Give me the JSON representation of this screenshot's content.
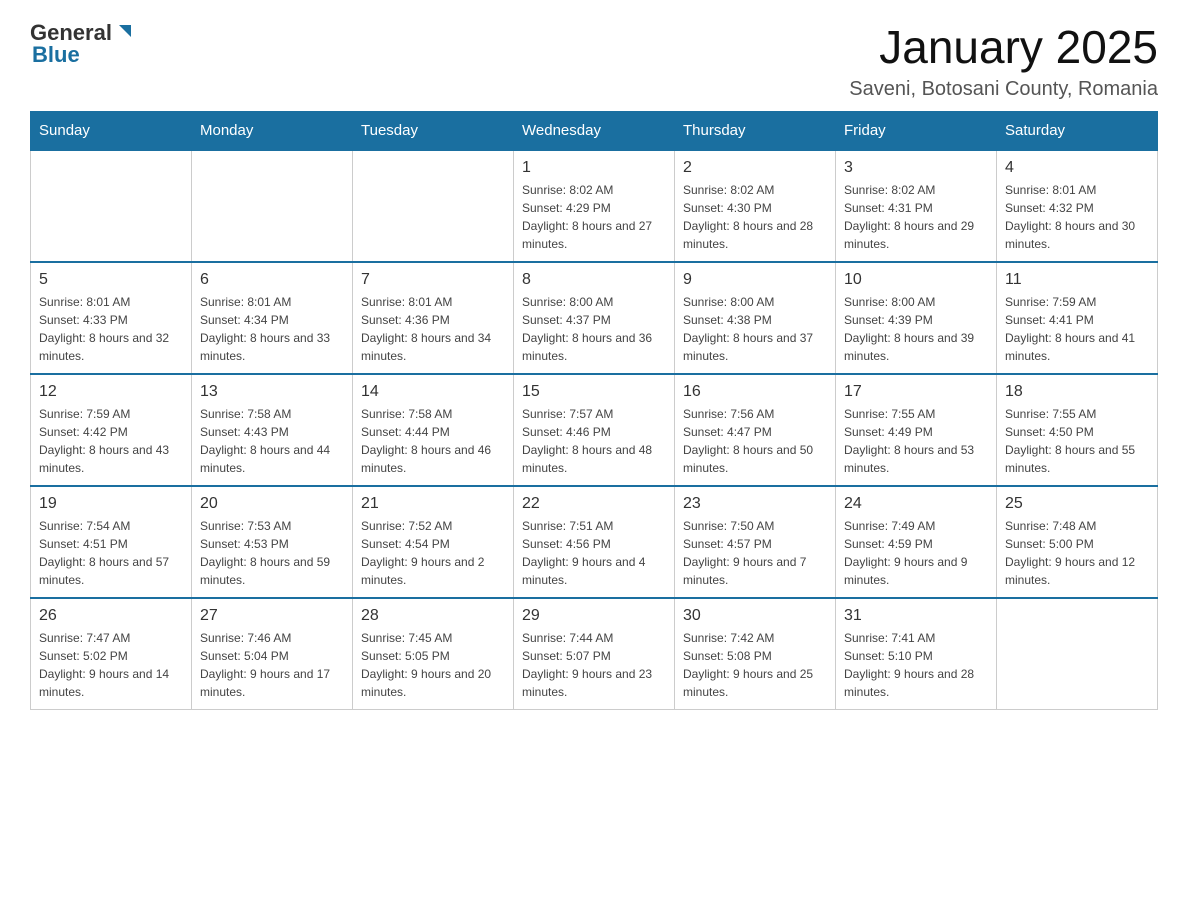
{
  "header": {
    "logo_general": "General",
    "logo_blue": "Blue",
    "title": "January 2025",
    "subtitle": "Saveni, Botosani County, Romania"
  },
  "days_of_week": [
    "Sunday",
    "Monday",
    "Tuesday",
    "Wednesday",
    "Thursday",
    "Friday",
    "Saturday"
  ],
  "weeks": [
    [
      {
        "day": "",
        "info": ""
      },
      {
        "day": "",
        "info": ""
      },
      {
        "day": "",
        "info": ""
      },
      {
        "day": "1",
        "info": "Sunrise: 8:02 AM\nSunset: 4:29 PM\nDaylight: 8 hours and 27 minutes."
      },
      {
        "day": "2",
        "info": "Sunrise: 8:02 AM\nSunset: 4:30 PM\nDaylight: 8 hours and 28 minutes."
      },
      {
        "day": "3",
        "info": "Sunrise: 8:02 AM\nSunset: 4:31 PM\nDaylight: 8 hours and 29 minutes."
      },
      {
        "day": "4",
        "info": "Sunrise: 8:01 AM\nSunset: 4:32 PM\nDaylight: 8 hours and 30 minutes."
      }
    ],
    [
      {
        "day": "5",
        "info": "Sunrise: 8:01 AM\nSunset: 4:33 PM\nDaylight: 8 hours and 32 minutes."
      },
      {
        "day": "6",
        "info": "Sunrise: 8:01 AM\nSunset: 4:34 PM\nDaylight: 8 hours and 33 minutes."
      },
      {
        "day": "7",
        "info": "Sunrise: 8:01 AM\nSunset: 4:36 PM\nDaylight: 8 hours and 34 minutes."
      },
      {
        "day": "8",
        "info": "Sunrise: 8:00 AM\nSunset: 4:37 PM\nDaylight: 8 hours and 36 minutes."
      },
      {
        "day": "9",
        "info": "Sunrise: 8:00 AM\nSunset: 4:38 PM\nDaylight: 8 hours and 37 minutes."
      },
      {
        "day": "10",
        "info": "Sunrise: 8:00 AM\nSunset: 4:39 PM\nDaylight: 8 hours and 39 minutes."
      },
      {
        "day": "11",
        "info": "Sunrise: 7:59 AM\nSunset: 4:41 PM\nDaylight: 8 hours and 41 minutes."
      }
    ],
    [
      {
        "day": "12",
        "info": "Sunrise: 7:59 AM\nSunset: 4:42 PM\nDaylight: 8 hours and 43 minutes."
      },
      {
        "day": "13",
        "info": "Sunrise: 7:58 AM\nSunset: 4:43 PM\nDaylight: 8 hours and 44 minutes."
      },
      {
        "day": "14",
        "info": "Sunrise: 7:58 AM\nSunset: 4:44 PM\nDaylight: 8 hours and 46 minutes."
      },
      {
        "day": "15",
        "info": "Sunrise: 7:57 AM\nSunset: 4:46 PM\nDaylight: 8 hours and 48 minutes."
      },
      {
        "day": "16",
        "info": "Sunrise: 7:56 AM\nSunset: 4:47 PM\nDaylight: 8 hours and 50 minutes."
      },
      {
        "day": "17",
        "info": "Sunrise: 7:55 AM\nSunset: 4:49 PM\nDaylight: 8 hours and 53 minutes."
      },
      {
        "day": "18",
        "info": "Sunrise: 7:55 AM\nSunset: 4:50 PM\nDaylight: 8 hours and 55 minutes."
      }
    ],
    [
      {
        "day": "19",
        "info": "Sunrise: 7:54 AM\nSunset: 4:51 PM\nDaylight: 8 hours and 57 minutes."
      },
      {
        "day": "20",
        "info": "Sunrise: 7:53 AM\nSunset: 4:53 PM\nDaylight: 8 hours and 59 minutes."
      },
      {
        "day": "21",
        "info": "Sunrise: 7:52 AM\nSunset: 4:54 PM\nDaylight: 9 hours and 2 minutes."
      },
      {
        "day": "22",
        "info": "Sunrise: 7:51 AM\nSunset: 4:56 PM\nDaylight: 9 hours and 4 minutes."
      },
      {
        "day": "23",
        "info": "Sunrise: 7:50 AM\nSunset: 4:57 PM\nDaylight: 9 hours and 7 minutes."
      },
      {
        "day": "24",
        "info": "Sunrise: 7:49 AM\nSunset: 4:59 PM\nDaylight: 9 hours and 9 minutes."
      },
      {
        "day": "25",
        "info": "Sunrise: 7:48 AM\nSunset: 5:00 PM\nDaylight: 9 hours and 12 minutes."
      }
    ],
    [
      {
        "day": "26",
        "info": "Sunrise: 7:47 AM\nSunset: 5:02 PM\nDaylight: 9 hours and 14 minutes."
      },
      {
        "day": "27",
        "info": "Sunrise: 7:46 AM\nSunset: 5:04 PM\nDaylight: 9 hours and 17 minutes."
      },
      {
        "day": "28",
        "info": "Sunrise: 7:45 AM\nSunset: 5:05 PM\nDaylight: 9 hours and 20 minutes."
      },
      {
        "day": "29",
        "info": "Sunrise: 7:44 AM\nSunset: 5:07 PM\nDaylight: 9 hours and 23 minutes."
      },
      {
        "day": "30",
        "info": "Sunrise: 7:42 AM\nSunset: 5:08 PM\nDaylight: 9 hours and 25 minutes."
      },
      {
        "day": "31",
        "info": "Sunrise: 7:41 AM\nSunset: 5:10 PM\nDaylight: 9 hours and 28 minutes."
      },
      {
        "day": "",
        "info": ""
      }
    ]
  ]
}
